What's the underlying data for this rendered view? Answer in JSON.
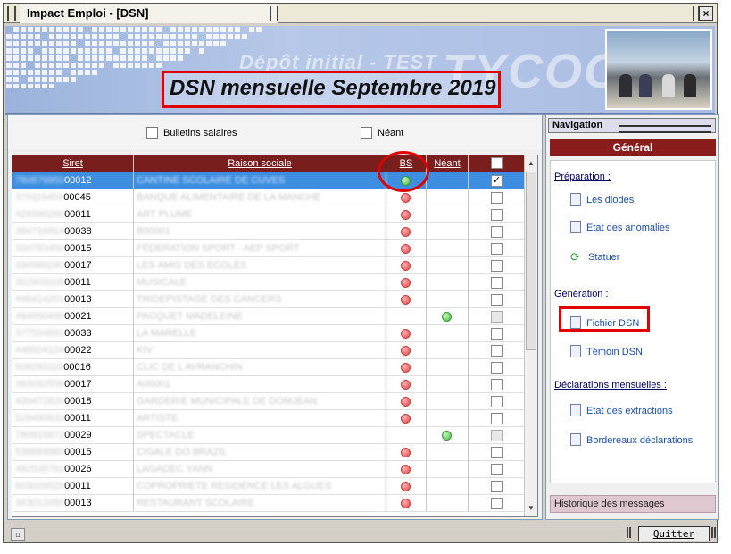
{
  "window": {
    "title": "Impact Emploi - [DSN]",
    "close_label": "×"
  },
  "banner": {
    "depot": "Dépôt initial - TEST",
    "logo": "TYCOON",
    "dsn_title": "DSN mensuelle Septembre 2019"
  },
  "filters": {
    "bulletins_label": "Bulletins salaires",
    "neant_label": "Néant"
  },
  "grid": {
    "columns": [
      "Siret",
      "Raison sociale",
      "BS",
      "Néant",
      ""
    ],
    "rows": [
      {
        "siret_blur": "780879950",
        "siret_tail": "00012",
        "raison": "CANTINE SCOLAIRE DE CUVES",
        "bs": "green",
        "neant": "",
        "checked": "✓",
        "selected": true
      },
      {
        "siret_blur": "379119400",
        "siret_tail": "00045",
        "raison": "BANQUE ALIMENTAIRE DE LA MANCHE",
        "bs": "red",
        "neant": "",
        "checked": "",
        "selected": false
      },
      {
        "siret_blur": "429390260",
        "siret_tail": "00011",
        "raison": "ART PLUME",
        "bs": "red",
        "neant": "",
        "checked": "",
        "selected": false
      },
      {
        "siret_blur": "394716914",
        "siret_tail": "00038",
        "raison": "B00001",
        "bs": "red",
        "neant": "",
        "checked": "",
        "selected": false
      },
      {
        "siret_blur": "334783450",
        "siret_tail": "00015",
        "raison": "FEDERATION SPORT - AEP SPORT",
        "bs": "red",
        "neant": "",
        "checked": "",
        "selected": false
      },
      {
        "siret_blur": "334960240",
        "siret_tail": "00017",
        "raison": "LES AMIS DES ECOLES",
        "bs": "red",
        "neant": "",
        "checked": "",
        "selected": false
      },
      {
        "siret_blur": "322903108",
        "siret_tail": "00011",
        "raison": "MUSICALE",
        "bs": "red",
        "neant": "",
        "checked": "",
        "selected": false
      },
      {
        "siret_blur": "448414201",
        "siret_tail": "00013",
        "raison": "TRIDEPISTAGE DES CANCERS",
        "bs": "red",
        "neant": "",
        "checked": "",
        "selected": false
      },
      {
        "siret_blur": "494950499",
        "siret_tail": "00021",
        "raison": "PACQUET MADELEINE",
        "bs": "",
        "neant": "green",
        "checked": "",
        "selected": false
      },
      {
        "siret_blur": "377504691",
        "siret_tail": "00033",
        "raison": "LA MARELLE",
        "bs": "red",
        "neant": "",
        "checked": "",
        "selected": false
      },
      {
        "siret_blur": "448504124",
        "siret_tail": "00022",
        "raison": "KIV",
        "bs": "red",
        "neant": "",
        "checked": "",
        "selected": false
      },
      {
        "siret_blur": "509293115",
        "siret_tail": "00016",
        "raison": "CLIC DE L AVRANCHIN",
        "bs": "red",
        "neant": "",
        "checked": "",
        "selected": false
      },
      {
        "siret_blur": "393092559",
        "siret_tail": "00017",
        "raison": "A00001",
        "bs": "red",
        "neant": "",
        "checked": "",
        "selected": false
      },
      {
        "siret_blur": "439472820",
        "siret_tail": "00018",
        "raison": "GARDERIE MUNICIPALE DE DOMJEAN",
        "bs": "red",
        "neant": "",
        "checked": "",
        "selected": false
      },
      {
        "siret_blur": "528490833",
        "siret_tail": "00011",
        "raison": "ARTISTE",
        "bs": "red",
        "neant": "",
        "checked": "",
        "selected": false
      },
      {
        "siret_blur": "780915872",
        "siret_tail": "00029",
        "raison": "SPECTACLE",
        "bs": "",
        "neant": "green",
        "checked": "",
        "selected": false
      },
      {
        "siret_blur": "538684960",
        "siret_tail": "00015",
        "raison": "CIGALE DO BRAZIL",
        "bs": "red",
        "neant": "",
        "checked": "",
        "selected": false
      },
      {
        "siret_blur": "492038781",
        "siret_tail": "00026",
        "raison": "LAGADEC YANN",
        "bs": "red",
        "neant": "",
        "checked": "",
        "selected": false
      },
      {
        "siret_blur": "803009529",
        "siret_tail": "00011",
        "raison": "COPROPRIETE RESIDENCE LES ALGUES",
        "bs": "red",
        "neant": "",
        "checked": "",
        "selected": false
      },
      {
        "siret_blur": "343012050",
        "siret_tail": "00013",
        "raison": "RESTAURANT SCOLAIRE",
        "bs": "red",
        "neant": "",
        "checked": "",
        "selected": false
      }
    ]
  },
  "nav": {
    "title": "Navigation",
    "general": "Général",
    "sections": [
      {
        "label": "Préparation :",
        "items": [
          {
            "label": "Les diodes",
            "icon": "document-search-icon"
          },
          {
            "label": "Etat des anomalies",
            "icon": "document-search-icon"
          },
          {
            "label": "Statuer",
            "icon": "refresh-icon"
          }
        ]
      },
      {
        "label": "Génération :",
        "items": [
          {
            "label": "Fichier DSN",
            "icon": "file-icon"
          },
          {
            "label": "Témoin DSN",
            "icon": "document-search-icon"
          }
        ]
      },
      {
        "label": "Déclarations mensuelles :",
        "items": [
          {
            "label": "Etat des extractions",
            "icon": "document-search-icon"
          },
          {
            "label": "Bordereaux déclarations",
            "icon": "document-search-icon"
          }
        ]
      }
    ],
    "history": "Historique des messages"
  },
  "status": {
    "quit_label": "Quitter"
  },
  "colors": {
    "header": "#7a1d1d",
    "general": "#8b1c1c",
    "selected_row": "#3d8ee0",
    "highlight": "#e00000"
  }
}
